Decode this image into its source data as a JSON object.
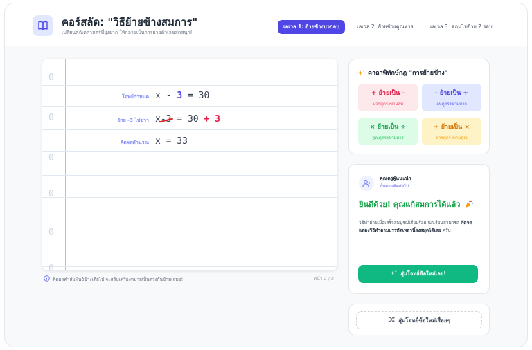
{
  "header": {
    "title": "คอร์สลัด: \"วิธีย้ายข้างสมการ\"",
    "subtitle": "เปลี่ยนคณิตศาสตร์ที่ยุ่งยาก ให้กลายเป็นการย้ายตัวเลขสุดสนุก!",
    "logo_icon": "book-icon",
    "levels": [
      {
        "label": "เลเวล 1: ย้ายข้างบวกลบ",
        "active": true
      },
      {
        "label": "เลเวล 2: ย้ายข้างคูณหาร",
        "active": false
      },
      {
        "label": "เลเวล 3: คอมโบย้าย 2 รอบ",
        "active": false
      }
    ]
  },
  "notebook": {
    "hole_marks": [
      "0",
      "0",
      "0",
      "0",
      "0",
      "0"
    ],
    "steps": [
      {
        "label": "โจทย์กำหนด",
        "eq_pre": "x - ",
        "eq_hl": "3",
        "eq_post": " = 30"
      },
      {
        "label": "ย้าย -3 ไปขวา",
        "eq_x": "x",
        "eq_struck": "-3",
        "eq_mid": " = 30 ",
        "eq_add": "+ 3"
      },
      {
        "label": "คิดผลคำนวณ",
        "eq_final": "x = 33"
      }
    ],
    "footer_note": "คิดผลคำสัมพันธ์ข้างเดียไป จะสลับเครื่องหมายเป็นตรงกันข้ามเสมอ!",
    "page_indicator": "หน้า 2 / 2"
  },
  "rules_panel": {
    "title": "คาถาพิทักษ์กฎ \"การย้ายข้าง\"",
    "icon": "sparkles-icon",
    "rules": [
      {
        "main": "+ ย้ายเป็น -",
        "sub": "บวกคู่ตรงข้ามลบ",
        "bg": "#fde8ec",
        "color": "#e11d48"
      },
      {
        "main": "- ย้ายเป็น +",
        "sub": "ลบคู่ตรงข้ามบวก",
        "bg": "#e0e7ff",
        "color": "#4f46e5"
      },
      {
        "main": "× ย้ายเป็น ÷",
        "sub": "คูณคู่ตรงข้ามหาร",
        "bg": "#dcfce7",
        "color": "#16a34a"
      },
      {
        "main": "÷ ย้ายเป็น ×",
        "sub": "หารคู่ตรงข้ามคูณ",
        "bg": "#fef3c7",
        "color": "#d97706"
      }
    ]
  },
  "teacher_panel": {
    "name": "คุณครูผู้แนะนำ",
    "subtitle": "ขั้นตอนคิดถัดไป",
    "congrats": "ยินดีด้วย! คุณแก้สมการได้แล้ว",
    "desc_pre": "วิธีทำย้ายเมื่อเสร็จสมบูรณ์เรียบร้อย นักเรียนสามารถ ",
    "desc_bold": "คัดจดแสดงวิธีทำตามบรรทัดเหล่านี้ลงสมุดได้เลย",
    "desc_post": " ครับ",
    "next_button": "สุ่มโจทย์ข้อใหม่เลย!"
  },
  "random_button": "สุ่มโจทย์ข้อใหม่เรื่อยๆ",
  "colors": {
    "primary": "#4f46e5",
    "success": "#10b981",
    "danger": "#e11d48"
  }
}
